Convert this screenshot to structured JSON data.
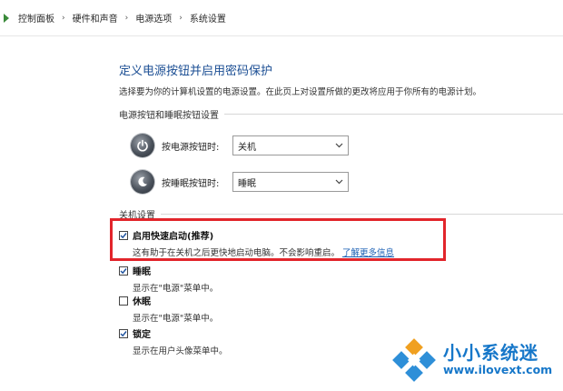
{
  "breadcrumb": {
    "items": [
      "控制面板",
      "硬件和声音",
      "电源选项",
      "系统设置"
    ],
    "separator": "›"
  },
  "page": {
    "title": "定义电源按钮并启用密码保护",
    "description": "选择要为你的计算机设置的电源设置。在此页上对设置所做的更改将应用于你所有的电源计划。"
  },
  "power_section": {
    "header": "电源按钮和睡眠按钮设置",
    "power_button": {
      "label": "按电源按钮时:",
      "value": "关机"
    },
    "sleep_button": {
      "label": "按睡眠按钮时:",
      "value": "睡眠"
    }
  },
  "shutdown_section": {
    "header": "关机设置",
    "fast_startup": {
      "label": "启用快速启动(推荐)",
      "checked": true,
      "desc": "这有助于在关机之后更快地启动电脑。不会影响重启。",
      "link": "了解更多信息"
    },
    "sleep": {
      "label": "睡眠",
      "checked": true,
      "desc": "显示在\"电源\"菜单中。"
    },
    "hibernate": {
      "label": "休眠",
      "checked": false,
      "desc": "显示在\"电源\"菜单中。"
    },
    "lock": {
      "label": "锁定",
      "checked": true,
      "desc": "显示在用户头像菜单中。"
    }
  },
  "watermark": {
    "name": "小小系统迷",
    "url": "www.ilovext.com"
  },
  "colors": {
    "title_blue": "#1c4f94",
    "link_blue": "#1a5fb4",
    "highlight_red": "#e2252b",
    "watermark_blue": "#1677c9"
  }
}
